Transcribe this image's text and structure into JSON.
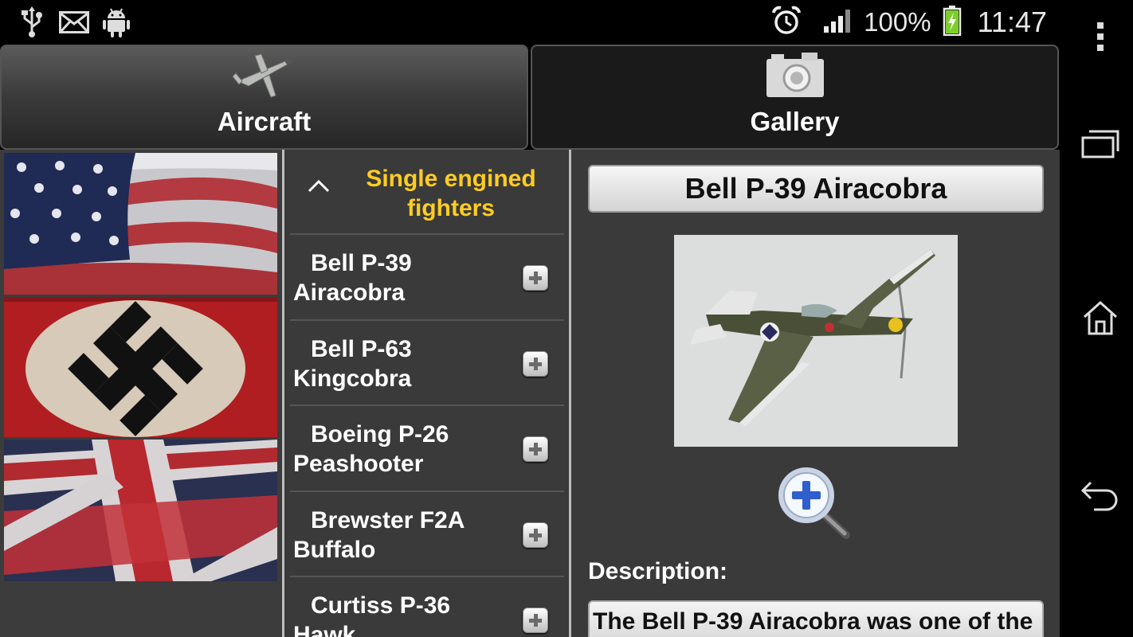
{
  "status_bar": {
    "battery": "100%",
    "time": "11:47",
    "icons": [
      "usb-icon",
      "email-icon",
      "android-debug-icon",
      "alarm-icon",
      "signal-icon",
      "battery-charging-icon"
    ]
  },
  "tabs": [
    {
      "label": "Aircraft",
      "icon": "airplane-icon",
      "selected": true
    },
    {
      "label": "Gallery",
      "icon": "camera-icon",
      "selected": false
    }
  ],
  "flags": [
    "usa-flag",
    "german-flag",
    "uk-flag"
  ],
  "list": {
    "group_title": "Single engined fighters",
    "items": [
      {
        "line1": "Bell P-39",
        "line2": "Airacobra"
      },
      {
        "line1": "Bell P-63",
        "line2": "Kingcobra"
      },
      {
        "line1": "Boeing P-26",
        "line2": "Peashooter"
      },
      {
        "line1": "Brewster F2A",
        "line2": "Buffalo"
      },
      {
        "line1": "Curtiss P-36",
        "line2": "Hawk"
      }
    ]
  },
  "detail": {
    "title": "Bell P-39 Airacobra",
    "description_label": "Description:",
    "description_text": "The Bell P-39 Airacobra was one of the"
  },
  "nav": [
    "menu-icon",
    "recent-apps-icon",
    "home-icon",
    "back-icon"
  ],
  "colors": {
    "group_title": "#ffcc22",
    "background": "#3a3a3a"
  }
}
